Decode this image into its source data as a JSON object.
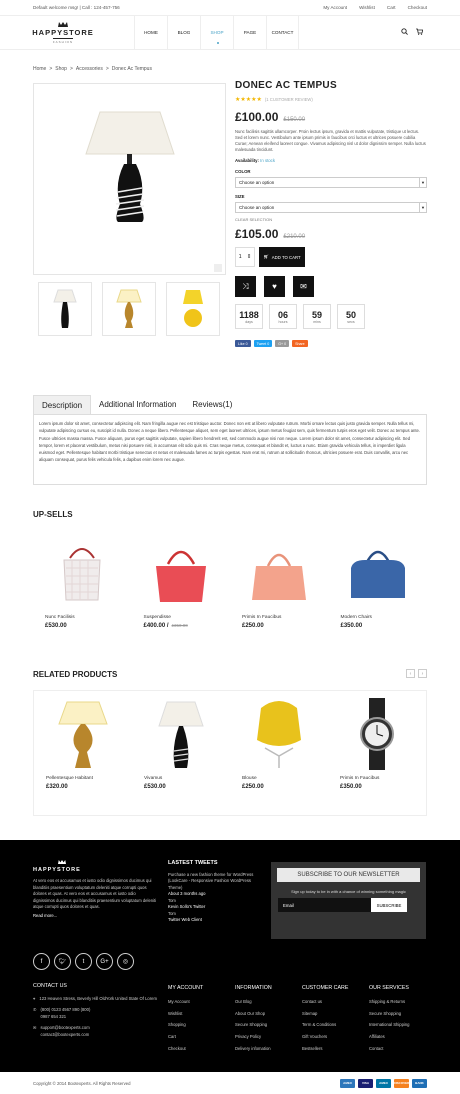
{
  "topbar": {
    "welcome": "Default welcome msg! | Call : 124-457-756",
    "links": [
      "My Account",
      "Wishlist",
      "Cart",
      "Checkout"
    ]
  },
  "header": {
    "brand": "HAPPYSTORE",
    "tagline": "FASHION",
    "nav": [
      "HOME",
      "BLOG",
      "SHOP",
      "PAGE",
      "CONTACT"
    ],
    "active": "SHOP",
    "icons": [
      "search-icon",
      "cart-icon"
    ]
  },
  "breadcrumb": [
    "Home",
    "Shop",
    "Accessories",
    "Donec Ac Tempus"
  ],
  "product": {
    "title": "DONEC AC TEMPUS",
    "rating": 5,
    "reviews": "(1 CUSTOMER REVIEW)",
    "price": "£100.00",
    "old_price": "£150.00",
    "description": "Nunc facilisis sagittis ullamcorper. Proin lectus ipsum, gravida et mattis vulputate, tristique ut lectus. Sed et lorem nunc. Vestibulum ante ipsum primis in faucibus orci luctus et ultrices posuere cubilia Curae; Aenean eleifend laoreet congue. Vivamus adipiscing nisl ut dolor dignissim semper. Nulla luctus malesuada tincidunt.",
    "availability_label": "Availability:",
    "availability": "In stock",
    "color_label": "COLOR",
    "color_placeholder": "Choose an option",
    "size_label": "SIZE",
    "size_placeholder": "Choose an option",
    "clear": "CLEAR SELECTION",
    "price2": "£105.00",
    "old_price2": "£210.00",
    "qty": "1",
    "add_to_cart": "ADD TO CART",
    "countdown": [
      {
        "value": "1188",
        "unit": "days"
      },
      {
        "value": "06",
        "unit": "hours"
      },
      {
        "value": "59",
        "unit": "mins"
      },
      {
        "value": "50",
        "unit": "secs"
      }
    ],
    "social": [
      {
        "label": "Like",
        "count": "0",
        "color": "#3b5998"
      },
      {
        "label": "Tweet",
        "count": "0",
        "color": "#1da1f2"
      },
      {
        "label": "G+",
        "count": "0",
        "color": "#999999"
      },
      {
        "label": "Share",
        "count": "",
        "color": "#f26522"
      }
    ]
  },
  "tabs": [
    "Description",
    "Additional Information",
    "Reviews(1)"
  ],
  "tab_body": "Lorem ipsum dolor sit amet, consectetur adipiscing elit. Nam fringilla augue nec est tristique auctor. Donec non est at libero vulputate rutrum. Morbi ornare lectus quis justo gravida semper. Nulla tellus mi, vulputate adipiscing cursus eu, suscipit id nulla. Donec a neque libero. Pellentesque aliquet, sem eget laoreet ultrices, ipsum metus feugiat sem, quis fermentum turpis eros eget velit. Donec ac tempus ante. Fusce ultricies massa massa. Fusce aliquam, purus eget sagittis vulputate, sapien libero hendrerit est, sed commodo augue nisi non neque. Lorem ipsum dolor sit amet, consectetur adipiscing elit. Sed tempor, lorem et placerat vestibulum, metus nisi posuere nisl, in accumsan elit odio quis mi. Cras neque metus, consequat et blandit et, luctus a nunc. Etiam gravida vehicula tellus, in imperdiet ligula euismod eget. Pellentesque habitant morbi tristique senectus et netus et malesuada fames ac turpis egestas. Nam erat mi, rutrum at sollicitudin rhoncus, ultricies posuere erat. Duis convallis, arcu nec aliquam consequat, purus felis vehicula felis, a dapibus enim lorem nec augue.",
  "upsells": {
    "title": "UP-SELLS",
    "items": [
      {
        "name": "Nunc Facilisis",
        "price": "£530.00",
        "old": ""
      },
      {
        "name": "Suspendisse",
        "price": "£400.00 /",
        "old": "£350.00"
      },
      {
        "name": "Primis In Faucibus",
        "price": "£250.00",
        "old": ""
      },
      {
        "name": "Modern Chairs",
        "price": "£350.00",
        "old": ""
      }
    ]
  },
  "related": {
    "title": "RELATED PRODUCTS",
    "items": [
      {
        "name": "Pellentesque Habitant",
        "price": "£320.00"
      },
      {
        "name": "Vivamus",
        "price": "£530.00"
      },
      {
        "name": "Blouse",
        "price": "£250.00"
      },
      {
        "name": "Primis In Faucibus",
        "price": "£350.00"
      }
    ]
  },
  "footer": {
    "brand": "HAPPYSTORE",
    "about": "At vero eos et accusamus et iusto odio dignissimos ducimus qui blanditiis praesentium voluptatum deleniti atque corrupti quos dolores et quas. At vero eos et accusamus et iusto odio dignissimos ducimus qui blanditiis praesentium voluptatum deleniti atque corrupti quos dolores et quas.",
    "read_more": "Read more...",
    "tweets_title": "LASTEST TWEETS",
    "tweet1": "Purchase a new fashion theme for WordPress (LookCare - Responsive Fashion WordPress Theme)",
    "tweet1_time": "About 3 months ago",
    "tweet1_by": "Tom",
    "tweet2": "Kevin Sollo's Twitter",
    "tweet2_by": "Tom",
    "tweet3": "Twitter Web Client",
    "news_title": "SUBSCRIBE TO OUR NEWSLETTER",
    "news_sub": "Sign up today to be in with a chance of winning something magic",
    "email_placeholder": "Email",
    "subscribe": "SUBSCRIBE",
    "social_icons": [
      "facebook-icon",
      "twitter-icon",
      "tumblr-icon",
      "google-plus-icon",
      "dribbble-icon"
    ],
    "contact_title": "CONTACT US",
    "address": "123 Heaven Stress, Beverly Hill OldYork United State Of Lorem",
    "phone": "(800) 0123 4567 890 (800) 0987 654 321",
    "email": "support@bootexperts.com contact@bootexperts.com",
    "columns": [
      {
        "title": "MY ACCOUNT",
        "items": [
          "My Account",
          "Wishlist",
          "Shopping",
          "Cart",
          "Checkout"
        ]
      },
      {
        "title": "INFORMATION",
        "items": [
          "Our Blog",
          "About Our Shop",
          "Secure Shopping",
          "Privacy Policy",
          "Delivery infomation"
        ]
      },
      {
        "title": "CUSTOMER CARE",
        "items": [
          "Contact us",
          "Sitemap",
          "Term & Conditions",
          "Gift Vouchers",
          "Bestsellers"
        ]
      },
      {
        "title": "OUR SERVICES",
        "items": [
          "Shipping & Returns",
          "Secure Shopping",
          "International Shipping",
          "Affiliates",
          "Contact"
        ]
      }
    ],
    "copyright": "Copyright © 2014 Bootexperts. All Rights Reserved",
    "cards": [
      {
        "label": "AMEX",
        "color": "#2e77bb"
      },
      {
        "label": "VISA",
        "color": "#1a1f71"
      },
      {
        "label": "AMEX",
        "color": "#0077a6"
      },
      {
        "label": "DISCOVER",
        "color": "#f58220"
      },
      {
        "label": "BANK",
        "color": "#1f6fb5"
      }
    ]
  }
}
